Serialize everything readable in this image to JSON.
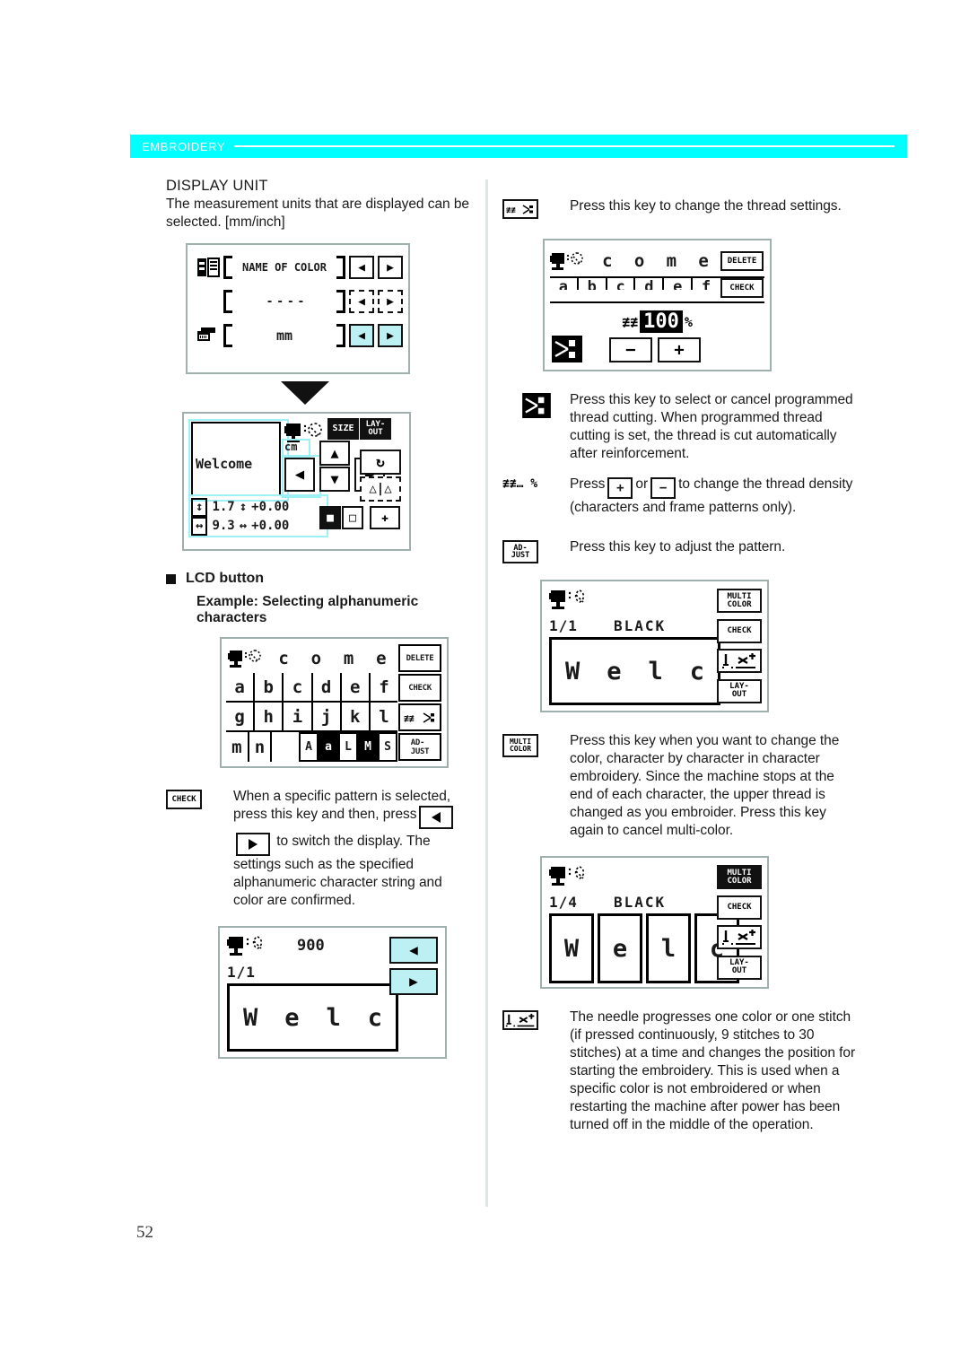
{
  "header": {
    "label": "EMBROIDERY"
  },
  "page": {
    "number": "52"
  },
  "left": {
    "section_title": "DISPLAY UNIT",
    "intro": "The measurement units that are displayed can be selected. [mm/inch]",
    "panel_display": {
      "icons": {
        "spool": "thread-spool-icon",
        "ruler": "ruler-icon"
      },
      "rows": [
        {
          "value": "NAME OF COLOR",
          "state": "normal"
        },
        {
          "value": "- - - -",
          "state": "dashed"
        },
        {
          "value": "mm",
          "state": "selected"
        }
      ],
      "arrow_left": "◀",
      "arrow_right": "▶"
    },
    "panel_welcome": {
      "preview_text": "Welcome",
      "unit_label": "cm",
      "size_label": "SIZE",
      "layout_label": "LAY-\nOUT",
      "dim_height_value": "1.7",
      "dim_height_offset": "+0.00",
      "dim_width_value": "9.3",
      "dim_width_offset": "+0.00"
    },
    "lcd_button_heading": "LCD button",
    "example_heading": "Example: Selecting alphanumeric characters",
    "panel_keys": {
      "preview_chars": [
        "c",
        "o",
        "m",
        "e"
      ],
      "rows": [
        [
          "a",
          "b",
          "c",
          "d",
          "e",
          "f"
        ],
        [
          "g",
          "h",
          "i",
          "j",
          "k",
          "l"
        ],
        [
          "m",
          "n",
          "",
          "",
          "",
          ""
        ]
      ],
      "func_delete": "DELETE",
      "func_check": "CHECK",
      "func_thread": "thread-density-icon",
      "func_adjust": "AD-\nJUST",
      "case_A": "A",
      "case_a": "a",
      "size_L": "L",
      "size_M": "M",
      "size_S": "S"
    },
    "check_note": {
      "key_label": "CHECK",
      "text_part1": "When a specific pattern is selected, press this key and then, press",
      "text_part2": "to switch the display. The settings such as the specified alphanumeric character string and color are confirmed."
    },
    "panel_900": {
      "number": "900",
      "page_counter": "1/1",
      "chars": [
        "W",
        "e",
        "l",
        "c"
      ],
      "arrow_left": "◀",
      "arrow_right": "▶"
    }
  },
  "right": {
    "note_thread_settings": {
      "key_label": "thread-density-icon",
      "text": "Press this key to change the thread settings."
    },
    "panel_thread": {
      "preview_chars": [
        "c",
        "o",
        "m",
        "e"
      ],
      "rows_partial": [
        "a",
        "b",
        "c",
        "d",
        "e",
        "f"
      ],
      "func_delete": "DELETE",
      "func_check": "CHECK",
      "density_value": "100",
      "density_unit": "%",
      "minus": "−",
      "plus": "+",
      "cut_icon": "thread-cut-icon"
    },
    "note_thread_cutting": {
      "key_label": "thread-cut-icon",
      "text": "Press this key to select or cancel programmed thread cutting. When programmed thread cutting is set, the thread is cut automatically after reinforcement."
    },
    "note_density": {
      "key_label": "… %",
      "text_before": "Press",
      "text_mid": "or",
      "text_after": "to change the thread density (characters and frame patterns only)."
    },
    "note_adjust": {
      "key_label": "AD-\nJUST",
      "text": "Press this key to adjust the pattern."
    },
    "panel_black1": {
      "page_counter": "1/1",
      "color_name": "BLACK",
      "chars": [
        "W",
        "e",
        "l",
        "c"
      ],
      "multi_color": "MULTI\nCOLOR",
      "check": "CHECK",
      "needle": "needle-progress-icon",
      "layout": "LAY-\nOUT"
    },
    "note_multicolor": {
      "key_label": "MULTI\nCOLOR",
      "text": "Press this key when you want to change the color, character by character in character embroidery. Since the machine stops at the end of each character, the upper thread is changed as you embroider. Press this key again to cancel multi-color."
    },
    "panel_black4": {
      "page_counter": "1/4",
      "color_name": "BLACK",
      "chars": [
        "W",
        "e",
        "l",
        "c"
      ],
      "multi_color": "MULTI\nCOLOR",
      "check": "CHECK",
      "needle": "needle-progress-icon",
      "layout": "LAY-\nOUT"
    },
    "note_needle": {
      "key_label": "needle-progress-icon",
      "text": "The needle progresses one color or one stitch (if pressed continuously, 9 stitches to 30 stitches) at a time and changes the position for starting the embroidery. This is used when a specific color is not embroidered or when restarting the machine after power has been turned off in the middle of the operation."
    }
  },
  "colors": {
    "header_band": "#00ffff",
    "lcd_border": "#9fb0ae",
    "highlight_cyan": "#bdf0f2",
    "divider": "#dce8e5"
  }
}
